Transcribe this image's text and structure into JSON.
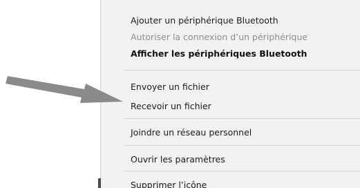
{
  "menu": {
    "items": [
      {
        "label": "Ajouter un périphérique Bluetooth",
        "state": "enabled"
      },
      {
        "label": "Autoriser la connexion d’un périphérique",
        "state": "disabled"
      },
      {
        "label": "Afficher les périphériques Bluetooth",
        "state": "default"
      },
      {
        "label": "Envoyer un fichier",
        "state": "enabled"
      },
      {
        "label": "Recevoir un fichier",
        "state": "enabled"
      },
      {
        "label": "Joindre un réseau personnel",
        "state": "enabled"
      },
      {
        "label": "Ouvrir les paramètres",
        "state": "enabled"
      },
      {
        "label": "Supprimer l’icône",
        "state": "enabled"
      }
    ]
  },
  "annotation": {
    "arrow_color": "#8a8a8a",
    "points_to": "Recevoir un fichier"
  }
}
